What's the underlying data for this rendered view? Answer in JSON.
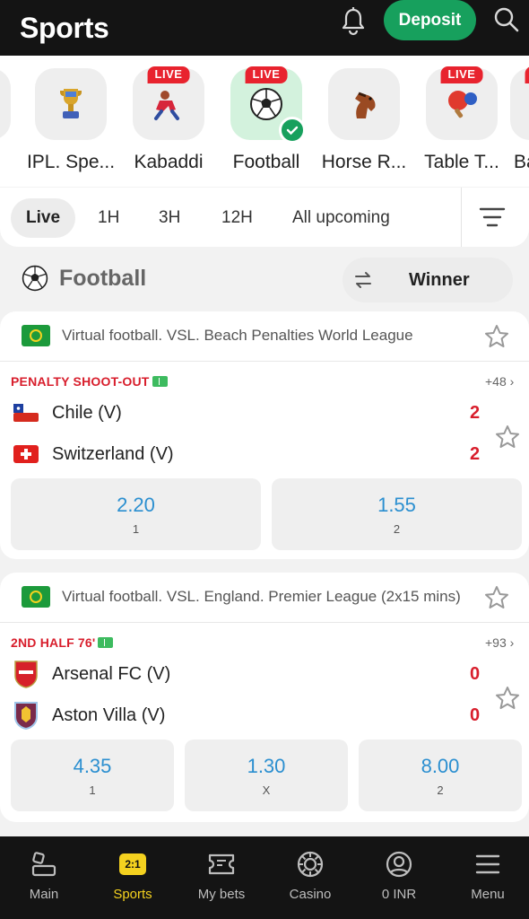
{
  "header": {
    "title": "Sports",
    "deposit_label": "Deposit"
  },
  "sports": [
    {
      "label": "IPL. Spe...",
      "icon": "trophy-icon",
      "live": false,
      "active": false
    },
    {
      "label": "Kabaddi",
      "icon": "kabaddi-icon",
      "live": true,
      "active": false
    },
    {
      "label": "Football",
      "icon": "football-icon",
      "live": true,
      "active": true
    },
    {
      "label": "Horse R...",
      "icon": "horse-icon",
      "live": false,
      "active": false
    },
    {
      "label": "Table T...",
      "icon": "table-tennis-icon",
      "live": true,
      "active": false
    },
    {
      "label": "Ba",
      "icon": "sport-icon",
      "live": true,
      "active": false
    }
  ],
  "live_tag": "LIVE",
  "filters": [
    "Live",
    "1H",
    "3H",
    "12H",
    "All upcoming"
  ],
  "section": {
    "title": "Football",
    "market": "Winner"
  },
  "matches": [
    {
      "league": "Virtual football. VSL. Beach Penalties World League",
      "status": "PENALTY SHOOT-OUT",
      "more": "+48",
      "team1": "Chile (V)",
      "score1": "2",
      "team2": "Switzerland (V)",
      "score2": "2",
      "odds": [
        {
          "value": "2.20",
          "label": "1"
        },
        {
          "value": "1.55",
          "label": "2"
        }
      ]
    },
    {
      "league": "Virtual football. VSL. England. Premier League (2x15 mins)",
      "status": "2ND HALF 76'",
      "more": "+93",
      "team1": "Arsenal FC (V)",
      "score1": "0",
      "team2": "Aston Villa (V)",
      "score2": "0",
      "odds": [
        {
          "value": "4.35",
          "label": "1"
        },
        {
          "value": "1.30",
          "label": "X"
        },
        {
          "value": "8.00",
          "label": "2"
        }
      ]
    }
  ],
  "nav": [
    {
      "label": "Main",
      "icon": "main-icon"
    },
    {
      "label": "Sports",
      "icon": "sports-icon",
      "badge": "2:1"
    },
    {
      "label": "My bets",
      "icon": "ticket-icon"
    },
    {
      "label": "Casino",
      "icon": "casino-chip-icon"
    },
    {
      "label": "0 INR",
      "icon": "account-icon"
    },
    {
      "label": "Menu",
      "icon": "menu-icon"
    }
  ],
  "colors": {
    "accent": "#17a05d",
    "live": "#e8232e",
    "odds": "#2b8fd0",
    "nav_active": "#f4d11f"
  }
}
